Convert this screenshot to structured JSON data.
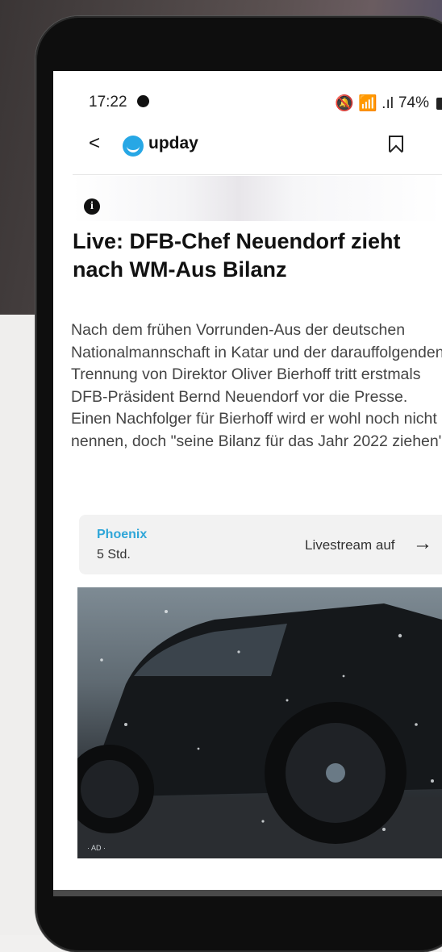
{
  "status_bar": {
    "time": "17:22",
    "indicators": "🔕 📶 .ıl",
    "battery": "74%"
  },
  "app_bar": {
    "back_glyph": "<",
    "logo_text": "upday",
    "bookmark_icon": "bookmark-icon"
  },
  "article": {
    "headline": "Live: DFB-Chef Neuendorf zieht nach WM-Aus Bilanz",
    "summary": "Nach dem frühen Vorrunden-Aus der deutschen Nationalmannschaft in Katar und der darauffolgenden Trennung von Direktor Oliver Bierhoff tritt erstmals DFB-Präsident Bernd Neuendorf vor die Presse. Einen Nachfolger für Bierhoff wird er wohl noch nicht nennen, doch \"seine Bilanz für das Jahr 2022 ziehen\"."
  },
  "source_card": {
    "source": "Phoenix",
    "age": "5 Std.",
    "cta": "Livestream auf",
    "arrow": "→"
  },
  "ad": {
    "label": "· AD ·"
  },
  "colors": {
    "accent": "#2fa6d8",
    "logo": "#27a7e5"
  }
}
